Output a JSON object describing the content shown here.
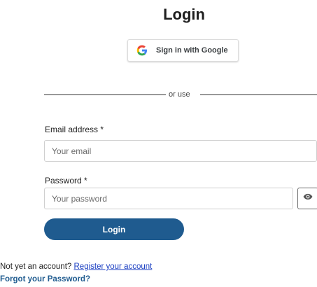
{
  "header": {
    "title": "Login"
  },
  "google": {
    "label": "Sign in with Google",
    "icon": "google-g-icon",
    "colors": {
      "blue": "#4285F4",
      "red": "#EA4335",
      "yellow": "#FBBC05",
      "green": "#34A853"
    }
  },
  "divider": {
    "text": "or use"
  },
  "form": {
    "email_label": "Email address *",
    "email_placeholder": "Your email",
    "email_value": "",
    "password_label": "Password *",
    "password_placeholder": "Your password",
    "password_value": "",
    "show_password_icon": "eye-icon",
    "submit_label": "Login"
  },
  "footer": {
    "register_prompt": "Not yet an account?",
    "register_link": "Register your account",
    "forgot_link": "Forgot your Password?"
  },
  "colors": {
    "primary": "#1F5B8F",
    "link": "#1A3EC2"
  }
}
